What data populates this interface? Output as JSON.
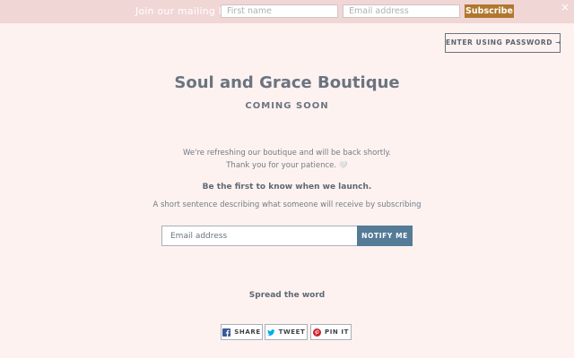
{
  "mailing_bar": {
    "label": "Join our mailing list",
    "first_name_placeholder": "First name",
    "email_placeholder": "Email address",
    "subscribe_label": "Subscribe",
    "close_symbol": "×"
  },
  "header": {
    "password_button_label": "ENTER USING PASSWORD →"
  },
  "main": {
    "title": "Soul and Grace Boutique",
    "subtitle": "COMING SOON",
    "message": "We're refreshing our boutique and will be back shortly. Thank you for your patience.",
    "heart_icon": "heart-icon",
    "launch_heading": "Be the first to know when we launch.",
    "description": "A short sentence describing what someone will receive by subscribing"
  },
  "newsletter": {
    "email_placeholder": "Email address",
    "notify_label": "NOTIFY ME"
  },
  "share": {
    "heading": "Spread the word",
    "buttons": [
      {
        "label": "SHARE",
        "icon": "facebook-icon",
        "color": "#3b5998"
      },
      {
        "label": "TWEET",
        "icon": "twitter-icon",
        "color": "#00aced"
      },
      {
        "label": "PIN IT",
        "icon": "pinterest-icon",
        "color": "#cb2128"
      }
    ]
  },
  "colors": {
    "background": "#fdf2f0",
    "topbar": "#f1d6d6",
    "subscribe_button": "#b0782e",
    "notify_button": "#557b97",
    "text": "#6b7480"
  }
}
